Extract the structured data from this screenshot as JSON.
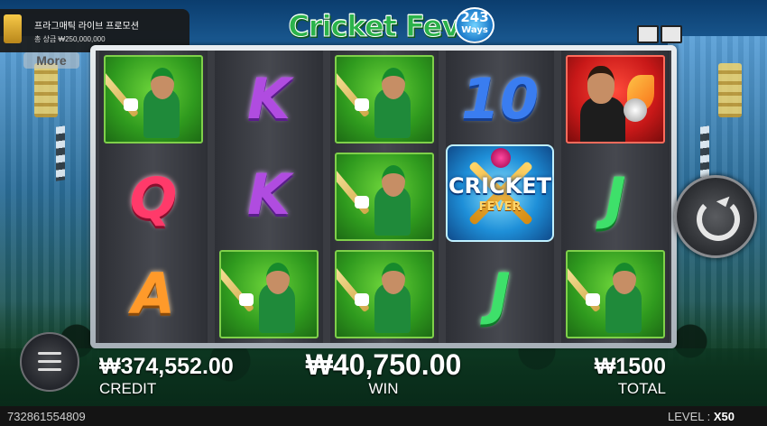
{
  "logo": {
    "title": "Cricket Fever",
    "ways_number": "243",
    "ways_word": "Ways"
  },
  "promo": {
    "title": "프라그매틱 라이브 프로모션",
    "subtitle": "총 상금 ₩250,000,000"
  },
  "more_button": "More",
  "reels": [
    {
      "symbols": [
        "player",
        "Q",
        "A"
      ]
    },
    {
      "symbols": [
        "K",
        "K",
        "player"
      ]
    },
    {
      "symbols": [
        "player",
        "player",
        "player"
      ]
    },
    {
      "symbols": [
        "10",
        "scatter",
        "J"
      ]
    },
    {
      "symbols": [
        "captain",
        "J",
        "player"
      ]
    }
  ],
  "scatter": {
    "line1": "CRICKET",
    "line2": "FEVER"
  },
  "credit": {
    "value": "₩374,552.00",
    "label": "CREDIT"
  },
  "win": {
    "value": "₩40,750.00",
    "label": "WIN"
  },
  "total": {
    "value": "₩1500",
    "label": "TOTAL"
  },
  "footer": {
    "game_id": "732861554809",
    "level_label": "LEVEL :",
    "level_value": "X50"
  },
  "icons": {
    "spin": "spin-refresh-icon",
    "menu": "hamburger-menu-icon",
    "top_right": [
      "sound-icon",
      "screen-icon"
    ]
  },
  "colors": {
    "player_bg": "#2f9a1e",
    "captain_bg": "#c81818",
    "K": "#b04ce0",
    "10": "#3a7df0",
    "Q": "#ff3a6a",
    "A": "#ff9a2a",
    "J": "#3ee06a"
  }
}
